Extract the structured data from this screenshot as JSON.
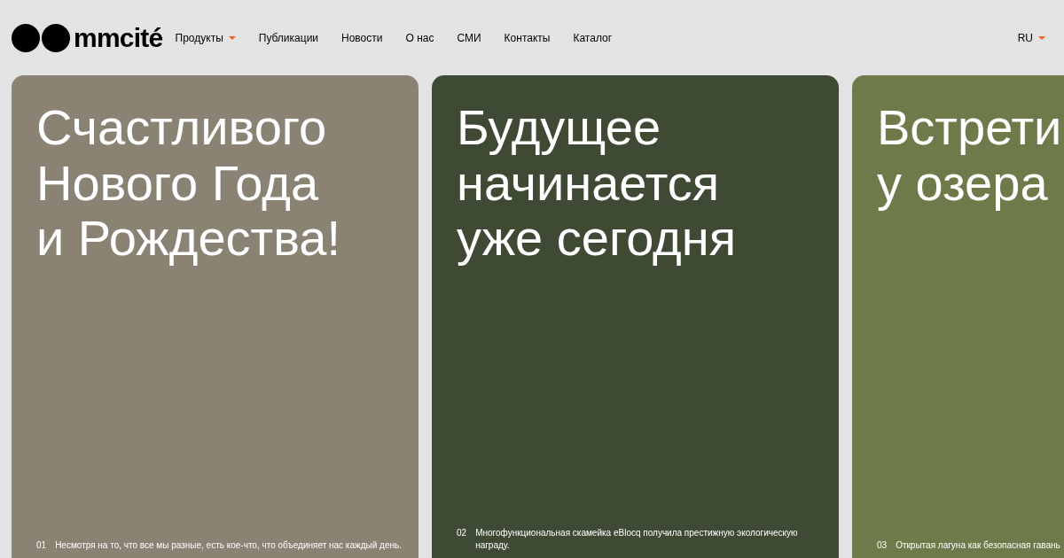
{
  "header": {
    "logo": "mmcité",
    "nav": [
      {
        "label": "Продукты",
        "dropdown": true
      },
      {
        "label": "Публикации",
        "dropdown": false
      },
      {
        "label": "Новости",
        "dropdown": false
      },
      {
        "label": "О нас",
        "dropdown": false
      },
      {
        "label": "СМИ",
        "dropdown": false
      },
      {
        "label": "Контакты",
        "dropdown": false
      },
      {
        "label": "Каталог",
        "dropdown": false
      }
    ],
    "language": "RU"
  },
  "cards": [
    {
      "title": [
        "Счастливого",
        "Нового Года",
        "и Рождества!"
      ],
      "number": "01",
      "caption": "Несмотря на то, что все мы разные, есть кое-что, что объединяет нас каждый день.",
      "color": "#8a8272"
    },
    {
      "title": [
        "Будущее",
        "начинается",
        "уже сегодня"
      ],
      "number": "02",
      "caption": "Многофункциональная скамейка eBlocq получила престижную экологическую награду.",
      "color": "#3e4a33"
    },
    {
      "title": [
        "Встрети",
        "у озера"
      ],
      "number": "03",
      "caption": "Открытая лагуна как безопасная гавань",
      "color": "#6f7a4a"
    }
  ]
}
